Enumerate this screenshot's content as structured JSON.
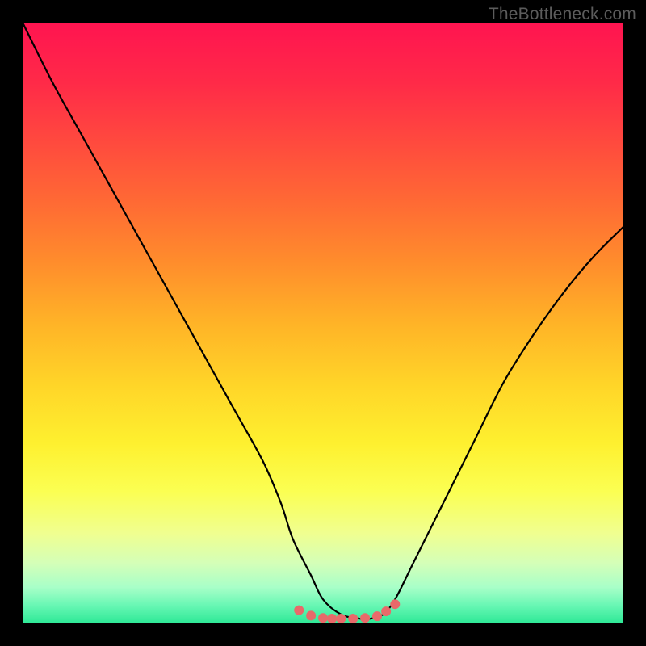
{
  "watermark": "TheBottleneck.com",
  "chart_data": {
    "type": "line",
    "title": "",
    "xlabel": "",
    "ylabel": "",
    "xlim": [
      0,
      100
    ],
    "ylim": [
      0,
      100
    ],
    "series": [
      {
        "name": "curve",
        "x": [
          0,
          5,
          10,
          15,
          20,
          25,
          30,
          35,
          40,
          43,
          45,
          48,
          50,
          53,
          56,
          58,
          60,
          62,
          65,
          70,
          75,
          80,
          85,
          90,
          95,
          100
        ],
        "y": [
          100,
          90,
          81,
          72,
          63,
          54,
          45,
          36,
          27,
          20,
          14,
          8,
          4,
          1.5,
          0.8,
          0.8,
          1.5,
          4,
          10,
          20,
          30,
          40,
          48,
          55,
          61,
          66
        ]
      }
    ],
    "markers": {
      "name": "bottom-cluster",
      "x": [
        46,
        48,
        50,
        51.5,
        53,
        55,
        57,
        59,
        60.5,
        62
      ],
      "y": [
        2.2,
        1.3,
        0.9,
        0.8,
        0.8,
        0.8,
        0.9,
        1.2,
        2.0,
        3.2
      ],
      "color": "#e86a6a",
      "radius": 6
    },
    "background_gradient": {
      "stops": [
        {
          "offset": 0.0,
          "color": "#ff1450"
        },
        {
          "offset": 0.1,
          "color": "#ff2a48"
        },
        {
          "offset": 0.2,
          "color": "#ff4a3e"
        },
        {
          "offset": 0.3,
          "color": "#ff6a34"
        },
        {
          "offset": 0.4,
          "color": "#ff8d2c"
        },
        {
          "offset": 0.5,
          "color": "#ffb327"
        },
        {
          "offset": 0.6,
          "color": "#ffd428"
        },
        {
          "offset": 0.7,
          "color": "#fef02f"
        },
        {
          "offset": 0.78,
          "color": "#fbff52"
        },
        {
          "offset": 0.85,
          "color": "#f0ff90"
        },
        {
          "offset": 0.9,
          "color": "#d4ffb8"
        },
        {
          "offset": 0.94,
          "color": "#a8ffc8"
        },
        {
          "offset": 0.97,
          "color": "#68f7b4"
        },
        {
          "offset": 1.0,
          "color": "#2de896"
        }
      ]
    }
  }
}
